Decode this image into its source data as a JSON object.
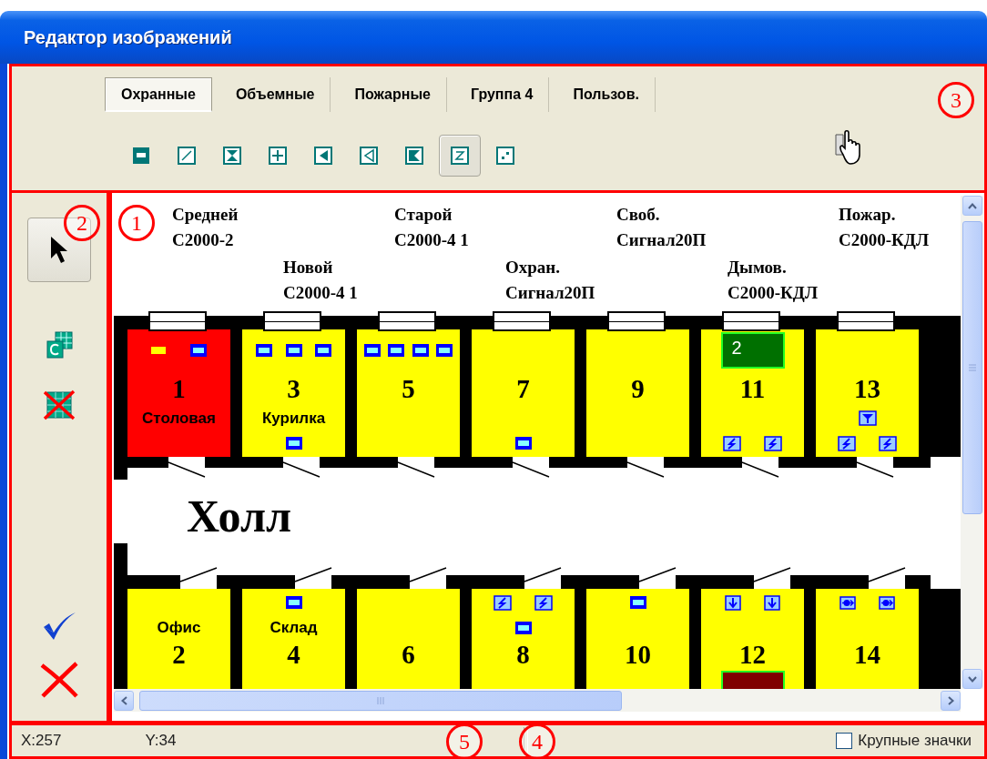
{
  "window": {
    "title": "Редактор изображений"
  },
  "tabs": [
    {
      "label": "Охранные",
      "selected": true
    },
    {
      "label": "Объемные",
      "selected": false
    },
    {
      "label": "Пожарные",
      "selected": false
    },
    {
      "label": "Группа 4",
      "selected": false
    },
    {
      "label": "Пользов.",
      "selected": false
    }
  ],
  "tools": [
    {
      "kind": "bar",
      "selected": false
    },
    {
      "kind": "slash",
      "selected": false
    },
    {
      "kind": "hourglass",
      "selected": false
    },
    {
      "kind": "split",
      "selected": false
    },
    {
      "kind": "left-solid",
      "selected": false
    },
    {
      "kind": "left-open",
      "selected": false
    },
    {
      "kind": "flag",
      "selected": false
    },
    {
      "kind": "z",
      "selected": true
    },
    {
      "kind": "dot",
      "selected": false
    }
  ],
  "side_tools": [
    {
      "kind": "pointer",
      "selected": true
    },
    {
      "kind": "copy",
      "selected": false
    },
    {
      "kind": "delete",
      "selected": false
    }
  ],
  "side_actions": [
    {
      "kind": "apply"
    },
    {
      "kind": "cancel"
    }
  ],
  "plan": {
    "devices": [
      {
        "name": "Средней",
        "model": "С2000-2"
      },
      {
        "name": "Новой",
        "model": "С2000-4 1"
      },
      {
        "name": "Старой",
        "model": "С2000-4 1"
      },
      {
        "name": "Охран.",
        "model": "Сигнал20П"
      },
      {
        "name": "Своб.",
        "model": "Сигнал20П"
      },
      {
        "name": "Дымов.",
        "model": "С2000-КДЛ"
      },
      {
        "name": "Пожар.",
        "model": "С2000-КДЛ"
      }
    ],
    "rooms_top": [
      {
        "number": "1",
        "name": "Столовая",
        "color": "#ff0000",
        "sensors_top": [
          {
            "kind": "small-bar"
          },
          {
            "kind": "bar"
          }
        ]
      },
      {
        "number": "3",
        "name": "Курилка",
        "color": "#ffff00",
        "sensors_top": [
          {
            "kind": "bar"
          },
          {
            "kind": "bar"
          },
          {
            "kind": "bar"
          }
        ],
        "sensors_bottom": [
          {
            "kind": "bar"
          }
        ]
      },
      {
        "number": "5",
        "color": "#ffff00",
        "sensors_top": [
          {
            "kind": "bar"
          },
          {
            "kind": "bar"
          },
          {
            "kind": "bar"
          },
          {
            "kind": "bar"
          }
        ]
      },
      {
        "number": "7",
        "color": "#ffff00",
        "sensors_bottom": [
          {
            "kind": "bar"
          }
        ]
      },
      {
        "number": "9",
        "color": "#ffff00"
      },
      {
        "number": "11",
        "color": "#ffff00",
        "indicator": {
          "text": "2",
          "color": "#007000"
        },
        "sensors_bottom": [
          {
            "kind": "lightning"
          },
          {
            "kind": "lightning"
          }
        ]
      },
      {
        "number": "13",
        "color": "#ffff00",
        "sensors_middle": [
          {
            "kind": "funnel"
          }
        ],
        "sensors_bottom": [
          {
            "kind": "lightning"
          },
          {
            "kind": "lightning"
          }
        ]
      }
    ],
    "hall": "Холл",
    "rooms_bottom": [
      {
        "number": "2",
        "name": "Офис",
        "color": "#ffff00"
      },
      {
        "number": "4",
        "name": "Склад",
        "color": "#ffff00",
        "sensors_top": [
          {
            "kind": "bar"
          }
        ]
      },
      {
        "number": "6",
        "color": "#ffff00"
      },
      {
        "number": "8",
        "color": "#ffff00",
        "sensors_top": [
          {
            "kind": "lightning"
          },
          {
            "kind": "lightning"
          }
        ],
        "sensors_middle": [
          {
            "kind": "bar"
          }
        ]
      },
      {
        "number": "10",
        "color": "#ffff00",
        "sensors_top": [
          {
            "kind": "bar"
          }
        ]
      },
      {
        "number": "12",
        "color": "#ffff00",
        "indicator": {
          "color": "#800000"
        },
        "sensors_top": [
          {
            "kind": "down"
          },
          {
            "kind": "down"
          }
        ]
      },
      {
        "number": "14",
        "color": "#ffff00",
        "sensors_top": [
          {
            "kind": "arrow"
          },
          {
            "kind": "arrow"
          }
        ]
      }
    ]
  },
  "status_bar": {
    "x": "X:257",
    "y": "Y:34",
    "large_icons": {
      "label": "Крупные значки",
      "checked": false
    }
  },
  "callouts": [
    "3",
    "2",
    "1",
    "5",
    "4"
  ]
}
